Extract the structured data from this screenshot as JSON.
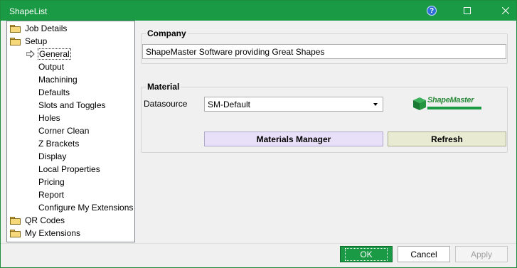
{
  "window": {
    "title": "ShapeList"
  },
  "titlebar": {
    "help_glyph": "?",
    "minimize_glyph": "☐",
    "close_glyph": "✕"
  },
  "tree": {
    "items": [
      {
        "label": "Job Details",
        "icon": "folder-icon"
      },
      {
        "label": "Setup",
        "icon": "folder-icon"
      },
      {
        "label": "General",
        "icon": "arrow-right-icon"
      },
      {
        "label": "Output"
      },
      {
        "label": "Machining"
      },
      {
        "label": "Defaults"
      },
      {
        "label": "Slots and Toggles"
      },
      {
        "label": "Holes"
      },
      {
        "label": "Corner Clean"
      },
      {
        "label": "Z Brackets"
      },
      {
        "label": "Display"
      },
      {
        "label": "Local Properties"
      },
      {
        "label": "Pricing"
      },
      {
        "label": "Report"
      },
      {
        "label": "Configure My Extensions"
      },
      {
        "label": "QR Codes",
        "icon": "folder-icon"
      },
      {
        "label": "My Extensions",
        "icon": "folder-icon"
      }
    ]
  },
  "company": {
    "title": "Company",
    "value": "ShapeMaster Software providing Great Shapes"
  },
  "material": {
    "title": "Material",
    "datasource_label": "Datasource",
    "datasource_value": "SM-Default",
    "materials_manager_label": "Materials Manager",
    "refresh_label": "Refresh",
    "logo_text": "ShapeMaster"
  },
  "footer": {
    "ok_label": "OK",
    "cancel_label": "Cancel",
    "apply_label": "Apply"
  },
  "colors": {
    "titlebar": "#1a9a44",
    "ok_button": "#1a9a44",
    "materials_manager_bg": "#e8e0f8",
    "refresh_bg": "#e8ead2"
  }
}
